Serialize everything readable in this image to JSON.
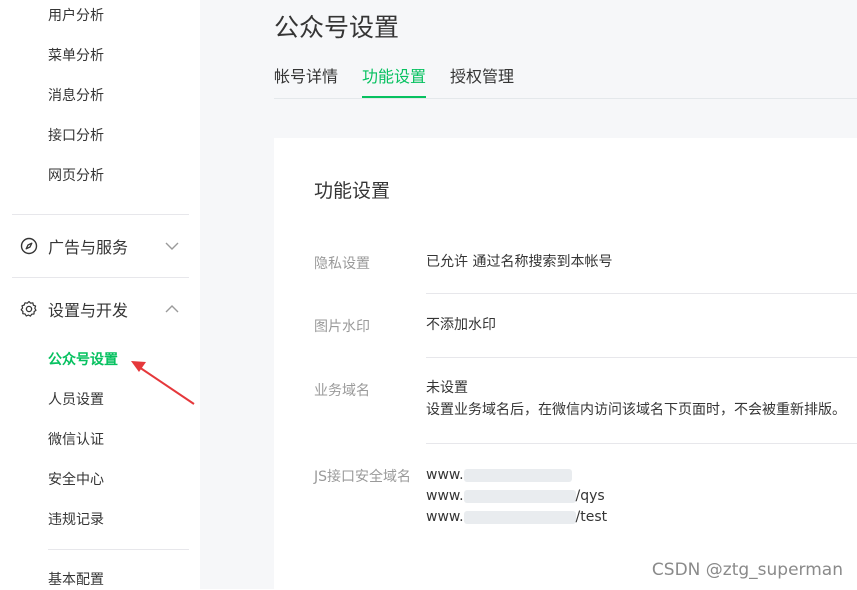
{
  "sidebar": {
    "items_top": [
      "用户分析",
      "菜单分析",
      "消息分析",
      "接口分析",
      "网页分析"
    ],
    "group_ads": {
      "label": "广告与服务",
      "icon": "compass-icon",
      "state": "collapsed"
    },
    "group_settings": {
      "label": "设置与开发",
      "icon": "gear-icon",
      "state": "expanded"
    },
    "items_settings": [
      "公众号设置",
      "人员设置",
      "微信认证",
      "安全中心",
      "违规记录"
    ],
    "active_item": "公众号设置",
    "items_bottom": [
      "基本配置"
    ]
  },
  "header": {
    "title": "公众号设置",
    "tabs": [
      {
        "label": "帐号详情"
      },
      {
        "label": "功能设置"
      },
      {
        "label": "授权管理"
      }
    ],
    "active_tab": "功能设置"
  },
  "card": {
    "title": "功能设置",
    "rows": [
      {
        "label": "隐私设置",
        "lines": [
          "已允许 通过名称搜索到本帐号"
        ]
      },
      {
        "label": "图片水印",
        "lines": [
          "不添加水印"
        ]
      },
      {
        "label": "业务域名",
        "lines": [
          "未设置",
          "设置业务域名后，在微信内访问该域名下页面时，不会被重新排版。"
        ]
      },
      {
        "label": "JS接口安全域名",
        "lines": [
          {
            "prefix": "www.",
            "suffix": ""
          },
          {
            "prefix": "www.",
            "suffix": "/qys"
          },
          {
            "prefix": "www.",
            "suffix": "/test"
          }
        ]
      }
    ]
  },
  "watermark": "CSDN @ztg_superman",
  "colors": {
    "accent": "#07c160",
    "annotation_arrow": "#e5383b",
    "label_gray": "#9a9a9a",
    "text": "#353535",
    "page_bg": "#f6f7f9"
  }
}
